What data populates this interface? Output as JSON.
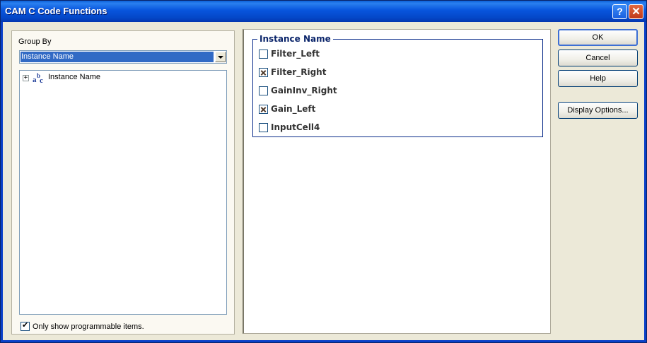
{
  "window": {
    "title": "CAM C Code Functions",
    "help_button": "?",
    "close_button": "✕"
  },
  "left_panel": {
    "group_by_label": "Group By",
    "group_by_selected": "Instance Name",
    "tree": [
      {
        "expander": "+",
        "label": "Instance Name"
      }
    ],
    "only_programmable": {
      "label": "Only show programmable items.",
      "checked": true
    }
  },
  "instance_group": {
    "title": "Instance Name",
    "items": [
      {
        "label": "Filter_Left",
        "checked": false
      },
      {
        "label": "Filter_Right",
        "checked": true
      },
      {
        "label": "GainInv_Right",
        "checked": false
      },
      {
        "label": "Gain_Left",
        "checked": true
      },
      {
        "label": "InputCell4",
        "checked": false
      }
    ]
  },
  "buttons": {
    "ok": "OK",
    "cancel": "Cancel",
    "help": "Help",
    "display_options": "Display Options..."
  }
}
